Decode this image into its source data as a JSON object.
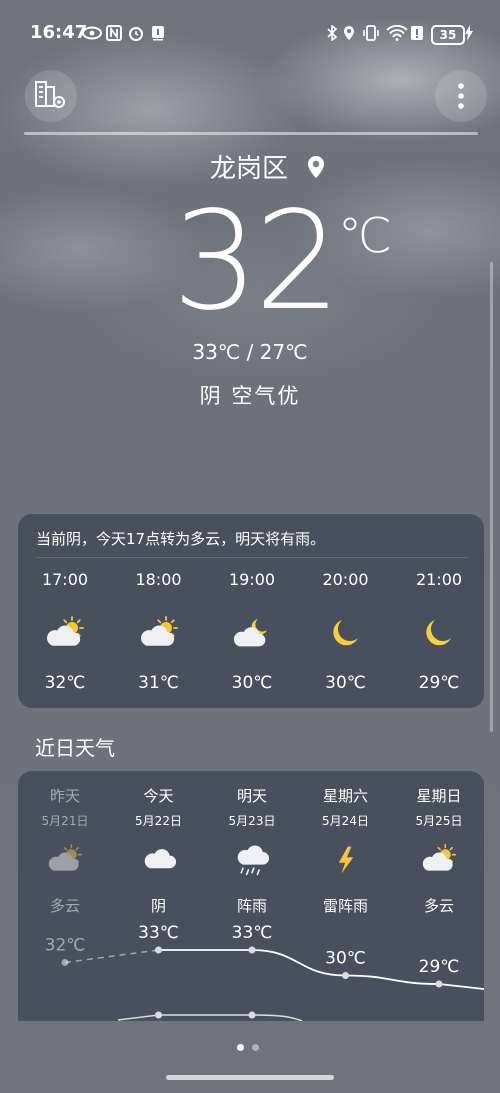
{
  "status": {
    "time": "16:47",
    "battery": "35"
  },
  "location": {
    "city": "龙岗区"
  },
  "current": {
    "temp": "32",
    "unit": "℃",
    "range": "33℃ / 27℃",
    "condition": "阴  空气优"
  },
  "hourly": {
    "summary": "当前阴，今天17点转为多云，明天将有雨。",
    "items": [
      {
        "time": "17:00",
        "icon": "partly-cloudy-day-icon",
        "temp": "32℃"
      },
      {
        "time": "18:00",
        "icon": "partly-cloudy-day-icon",
        "temp": "31℃"
      },
      {
        "time": "19:00",
        "icon": "partly-cloudy-night-icon",
        "temp": "30℃"
      },
      {
        "time": "20:00",
        "icon": "moon-icon",
        "temp": "30℃"
      },
      {
        "time": "21:00",
        "icon": "moon-icon",
        "temp": "29℃"
      }
    ]
  },
  "daily": {
    "title": "近日天气",
    "items": [
      {
        "name": "昨天",
        "date": "5月21日",
        "icon": "partly-cloudy-day-icon",
        "cond": "多云",
        "high": "32℃",
        "high_value": 32
      },
      {
        "name": "今天",
        "date": "5月22日",
        "icon": "cloud-icon",
        "cond": "阴",
        "high": "33℃",
        "high_value": 33
      },
      {
        "name": "明天",
        "date": "5月23日",
        "icon": "shower-icon",
        "cond": "阵雨",
        "high": "33℃",
        "high_value": 33
      },
      {
        "name": "星期六",
        "date": "5月24日",
        "icon": "thunder-icon",
        "cond": "雷阵雨",
        "high": "30℃",
        "high_value": 30
      },
      {
        "name": "星期日",
        "date": "5月25日",
        "icon": "partly-cloudy-day-icon",
        "cond": "多云",
        "high": "29℃",
        "high_value": 29
      }
    ]
  },
  "colors": {
    "sun": "#f7c53a",
    "cloud": "#eef0f3",
    "moon": "#f6cf3a"
  },
  "pager": {
    "pages": 2,
    "current": 1
  }
}
